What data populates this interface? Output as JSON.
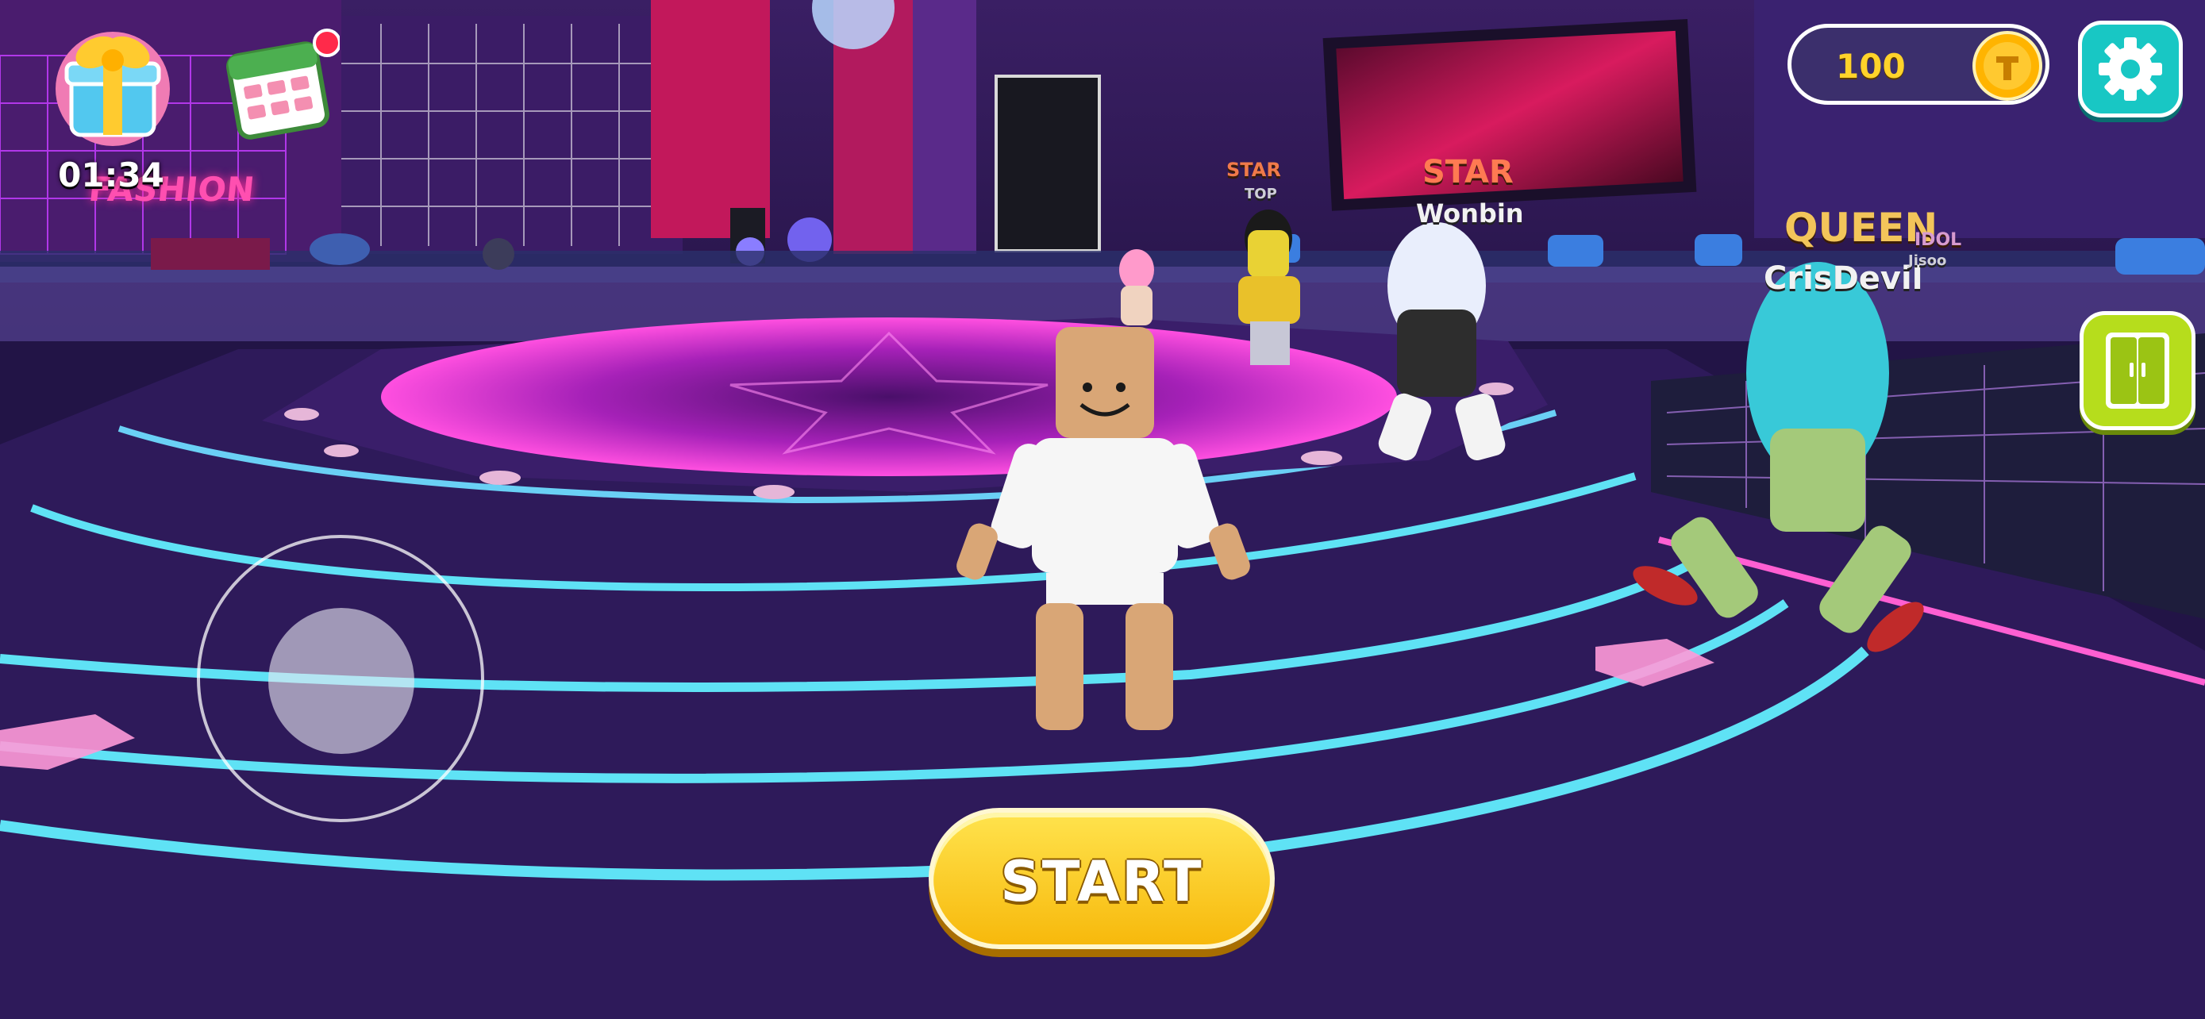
{
  "hud": {
    "gift_timer": "01:34",
    "coins": "100",
    "start_label": "START"
  },
  "scene": {
    "sign_text": "FASHION",
    "players": [
      {
        "title": "STAR",
        "subtitle": "TOP"
      },
      {
        "title": "STAR",
        "name": "Wonbin"
      },
      {
        "title": "QUEEN",
        "name": "CrisDevil"
      },
      {
        "title": "IDOL",
        "name": "Jisoo"
      }
    ]
  },
  "colors": {
    "floor_purple": "#3e2470",
    "neon_cyan": "#5fe2f5",
    "neon_pink": "#ff3fc9",
    "start_yellow": "#ffd21a",
    "settings_teal": "#18c7c4",
    "wardrobe_green": "#b6dd1c",
    "coin_gold": "#ffb400"
  },
  "icons": {
    "gift": "gift-box-icon",
    "calendar": "calendar-icon",
    "coin": "coin-icon",
    "settings": "gear-icon",
    "wardrobe": "wardrobe-icon"
  }
}
